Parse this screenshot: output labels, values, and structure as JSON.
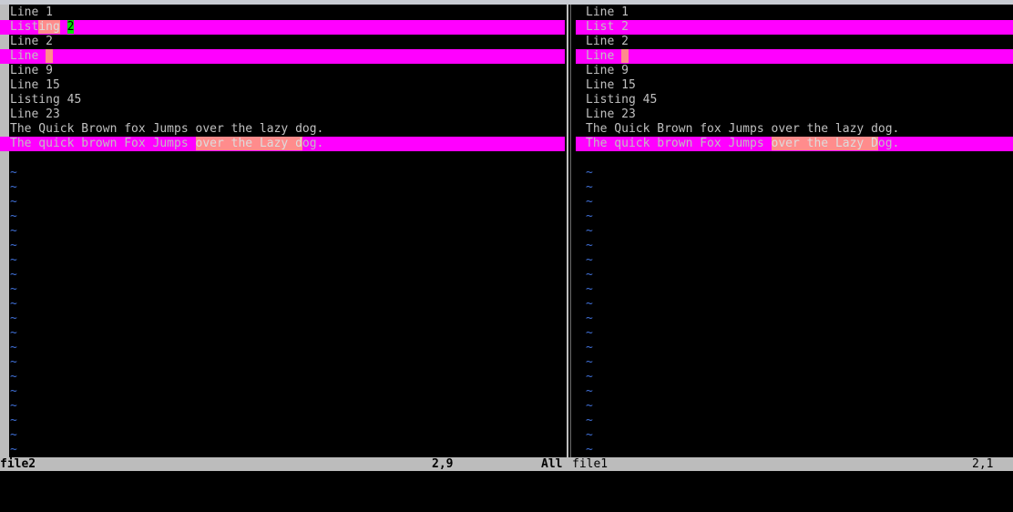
{
  "left": {
    "lines": [
      {
        "changed": false,
        "segs": [
          {
            "t": "Line 1"
          }
        ]
      },
      {
        "changed": true,
        "segs": [
          {
            "t": "List"
          },
          {
            "t": "ing",
            "hl": true
          },
          {
            "t": " "
          },
          {
            "t": "2",
            "add": true
          }
        ]
      },
      {
        "changed": false,
        "segs": [
          {
            "t": "Line 2"
          }
        ]
      },
      {
        "changed": true,
        "segs": [
          {
            "t": "Line "
          },
          {
            "t": " ",
            "hl": true
          }
        ]
      },
      {
        "changed": false,
        "segs": [
          {
            "t": "Line 9"
          }
        ]
      },
      {
        "changed": false,
        "segs": [
          {
            "t": "Line 15"
          }
        ]
      },
      {
        "changed": false,
        "segs": [
          {
            "t": "Listing 45"
          }
        ]
      },
      {
        "changed": false,
        "segs": [
          {
            "t": "Line 23"
          }
        ]
      },
      {
        "changed": false,
        "segs": [
          {
            "t": "The Quick Brown fox Jumps over the lazy dog."
          }
        ]
      },
      {
        "changed": true,
        "segs": [
          {
            "t": "The quick brown Fox Jumps "
          },
          {
            "t": "over the Lazy d",
            "hl": true
          },
          {
            "t": "og."
          }
        ]
      }
    ]
  },
  "right": {
    "lines": [
      {
        "changed": false,
        "segs": [
          {
            "t": "Line 1"
          }
        ]
      },
      {
        "changed": true,
        "segs": [
          {
            "t": "List 2"
          }
        ]
      },
      {
        "changed": false,
        "segs": [
          {
            "t": "Line 2"
          }
        ]
      },
      {
        "changed": true,
        "segs": [
          {
            "t": "Line "
          },
          {
            "t": " ",
            "hl": true
          }
        ]
      },
      {
        "changed": false,
        "segs": [
          {
            "t": "Line 9"
          }
        ]
      },
      {
        "changed": false,
        "segs": [
          {
            "t": "Line 15"
          }
        ]
      },
      {
        "changed": false,
        "segs": [
          {
            "t": "Listing 45"
          }
        ]
      },
      {
        "changed": false,
        "segs": [
          {
            "t": "Line 23"
          }
        ]
      },
      {
        "changed": false,
        "segs": [
          {
            "t": "The Quick Brown fox Jumps over the lazy dog."
          }
        ]
      },
      {
        "changed": true,
        "segs": [
          {
            "t": "The quick brown Fox Jumps "
          },
          {
            "t": "over the Lazy D",
            "hl": true
          },
          {
            "t": "og."
          }
        ]
      }
    ]
  },
  "filler_char": "~",
  "filler_count": 20,
  "status_left": {
    "filename": "file2",
    "position": "2,9",
    "scroll": "All"
  },
  "status_right": {
    "filename": "file1",
    "position": "2,1"
  },
  "colors": {
    "diff_change": "#ff00ff",
    "diff_text": "#ff8c8c",
    "diff_add": "#00e000",
    "nontext_tilde": "#3f6fd6",
    "statusline": "#bcbcbc"
  }
}
